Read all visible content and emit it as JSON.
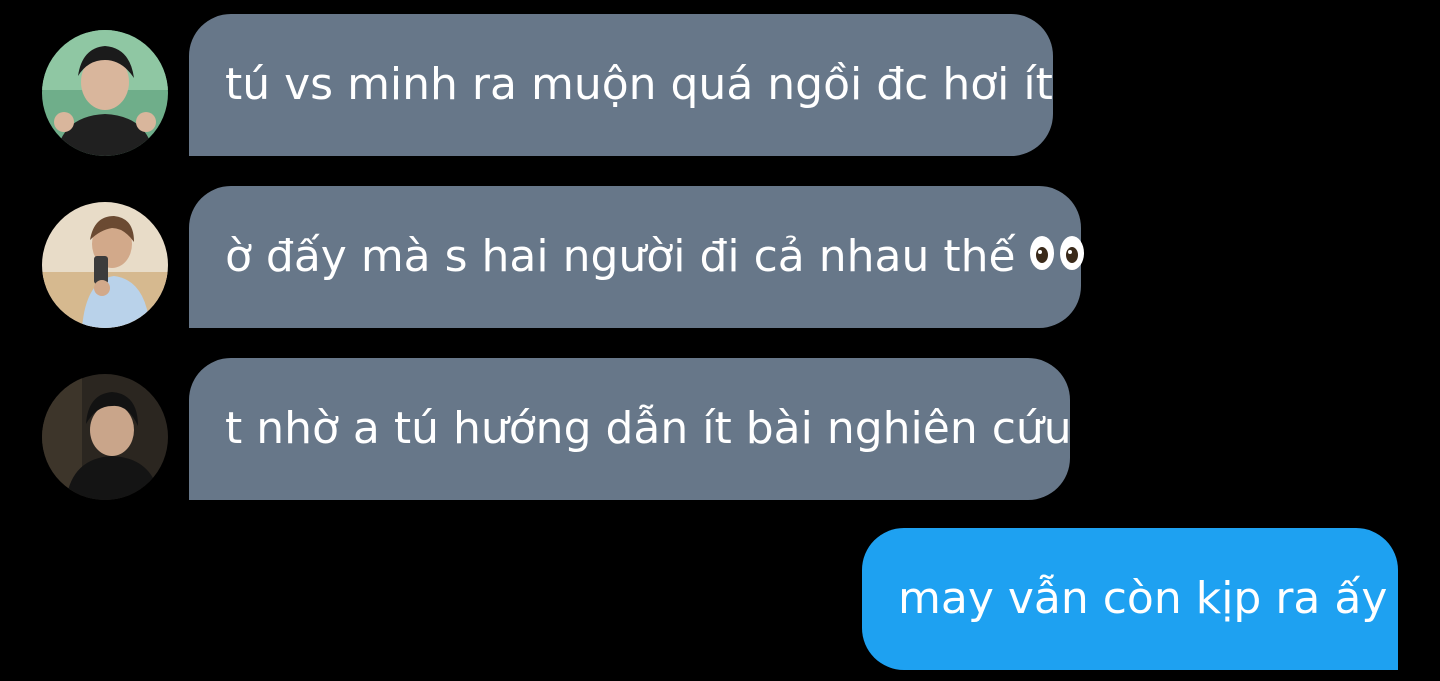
{
  "messages": [
    {
      "direction": "incoming",
      "text": "tú vs minh ra muộn quá ngồi đc hơi ít",
      "avatar": "user-photo-1"
    },
    {
      "direction": "incoming",
      "text": "ờ đấy mà s hai người đi cả nhau thế",
      "emoji": "eyes-icon",
      "avatar": "user-photo-2"
    },
    {
      "direction": "incoming",
      "text": "t nhờ a tú hướng dẫn ít bài nghiên cứu",
      "avatar": "user-photo-3"
    },
    {
      "direction": "outgoing",
      "text": "may vẫn còn kịp ra ấy"
    }
  ],
  "colors": {
    "background": "#000000",
    "incoming_bubble": "#677789",
    "outgoing_bubble": "#1ea1f1",
    "text": "#ffffff"
  }
}
